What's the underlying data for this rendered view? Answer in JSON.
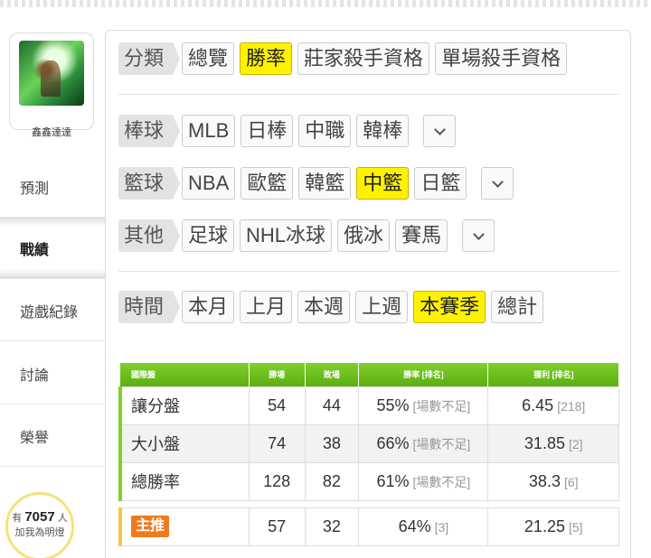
{
  "sidebar": {
    "username": "鑫鑫達達",
    "menu": [
      "預測",
      "戰績",
      "遊戲紀錄",
      "討論",
      "榮譽"
    ],
    "active": "戰績",
    "fans": {
      "prefix": "有",
      "count": "7057",
      "suffix": "人",
      "text": "加我為明燈"
    }
  },
  "filters": {
    "category": {
      "label": "分類",
      "options": [
        "總覽",
        "勝率",
        "莊家殺手資格",
        "單場殺手資格"
      ],
      "selected": "勝率"
    },
    "baseball": {
      "label": "棒球",
      "options": [
        "MLB",
        "日棒",
        "中職",
        "韓棒"
      ],
      "selected": ""
    },
    "basketball": {
      "label": "籃球",
      "options": [
        "NBA",
        "歐籃",
        "韓籃",
        "中籃",
        "日籃"
      ],
      "selected": "中籃"
    },
    "other": {
      "label": "其他",
      "options": [
        "足球",
        "NHL冰球",
        "俄冰",
        "賽馬"
      ],
      "selected": ""
    },
    "time": {
      "label": "時間",
      "options": [
        "本月",
        "上月",
        "本週",
        "上週",
        "本賽季",
        "總計"
      ],
      "selected": "本賽季"
    }
  },
  "table": {
    "headers": [
      "國際盤",
      "勝場",
      "敗場",
      "勝率 [排名]",
      "獲利 [排名]"
    ],
    "rows": [
      {
        "name": "讓分盤",
        "wins": "54",
        "losses": "44",
        "rate": "55%",
        "rate_rank": "[場數不足]",
        "profit": "6.45",
        "profit_rank": "[218]"
      },
      {
        "name": "大小盤",
        "wins": "74",
        "losses": "38",
        "rate": "66%",
        "rate_rank": "[場數不足]",
        "profit": "31.85",
        "profit_rank": "[2]"
      },
      {
        "name": "總勝率",
        "wins": "128",
        "losses": "82",
        "rate": "61%",
        "rate_rank": "[場數不足]",
        "profit": "38.3",
        "profit_rank": "[6]"
      }
    ],
    "main": {
      "badge": "主推",
      "wins": "57",
      "losses": "32",
      "rate": "64%",
      "rate_rank": "[3]",
      "profit": "21.25",
      "profit_rank": "[5]"
    }
  }
}
